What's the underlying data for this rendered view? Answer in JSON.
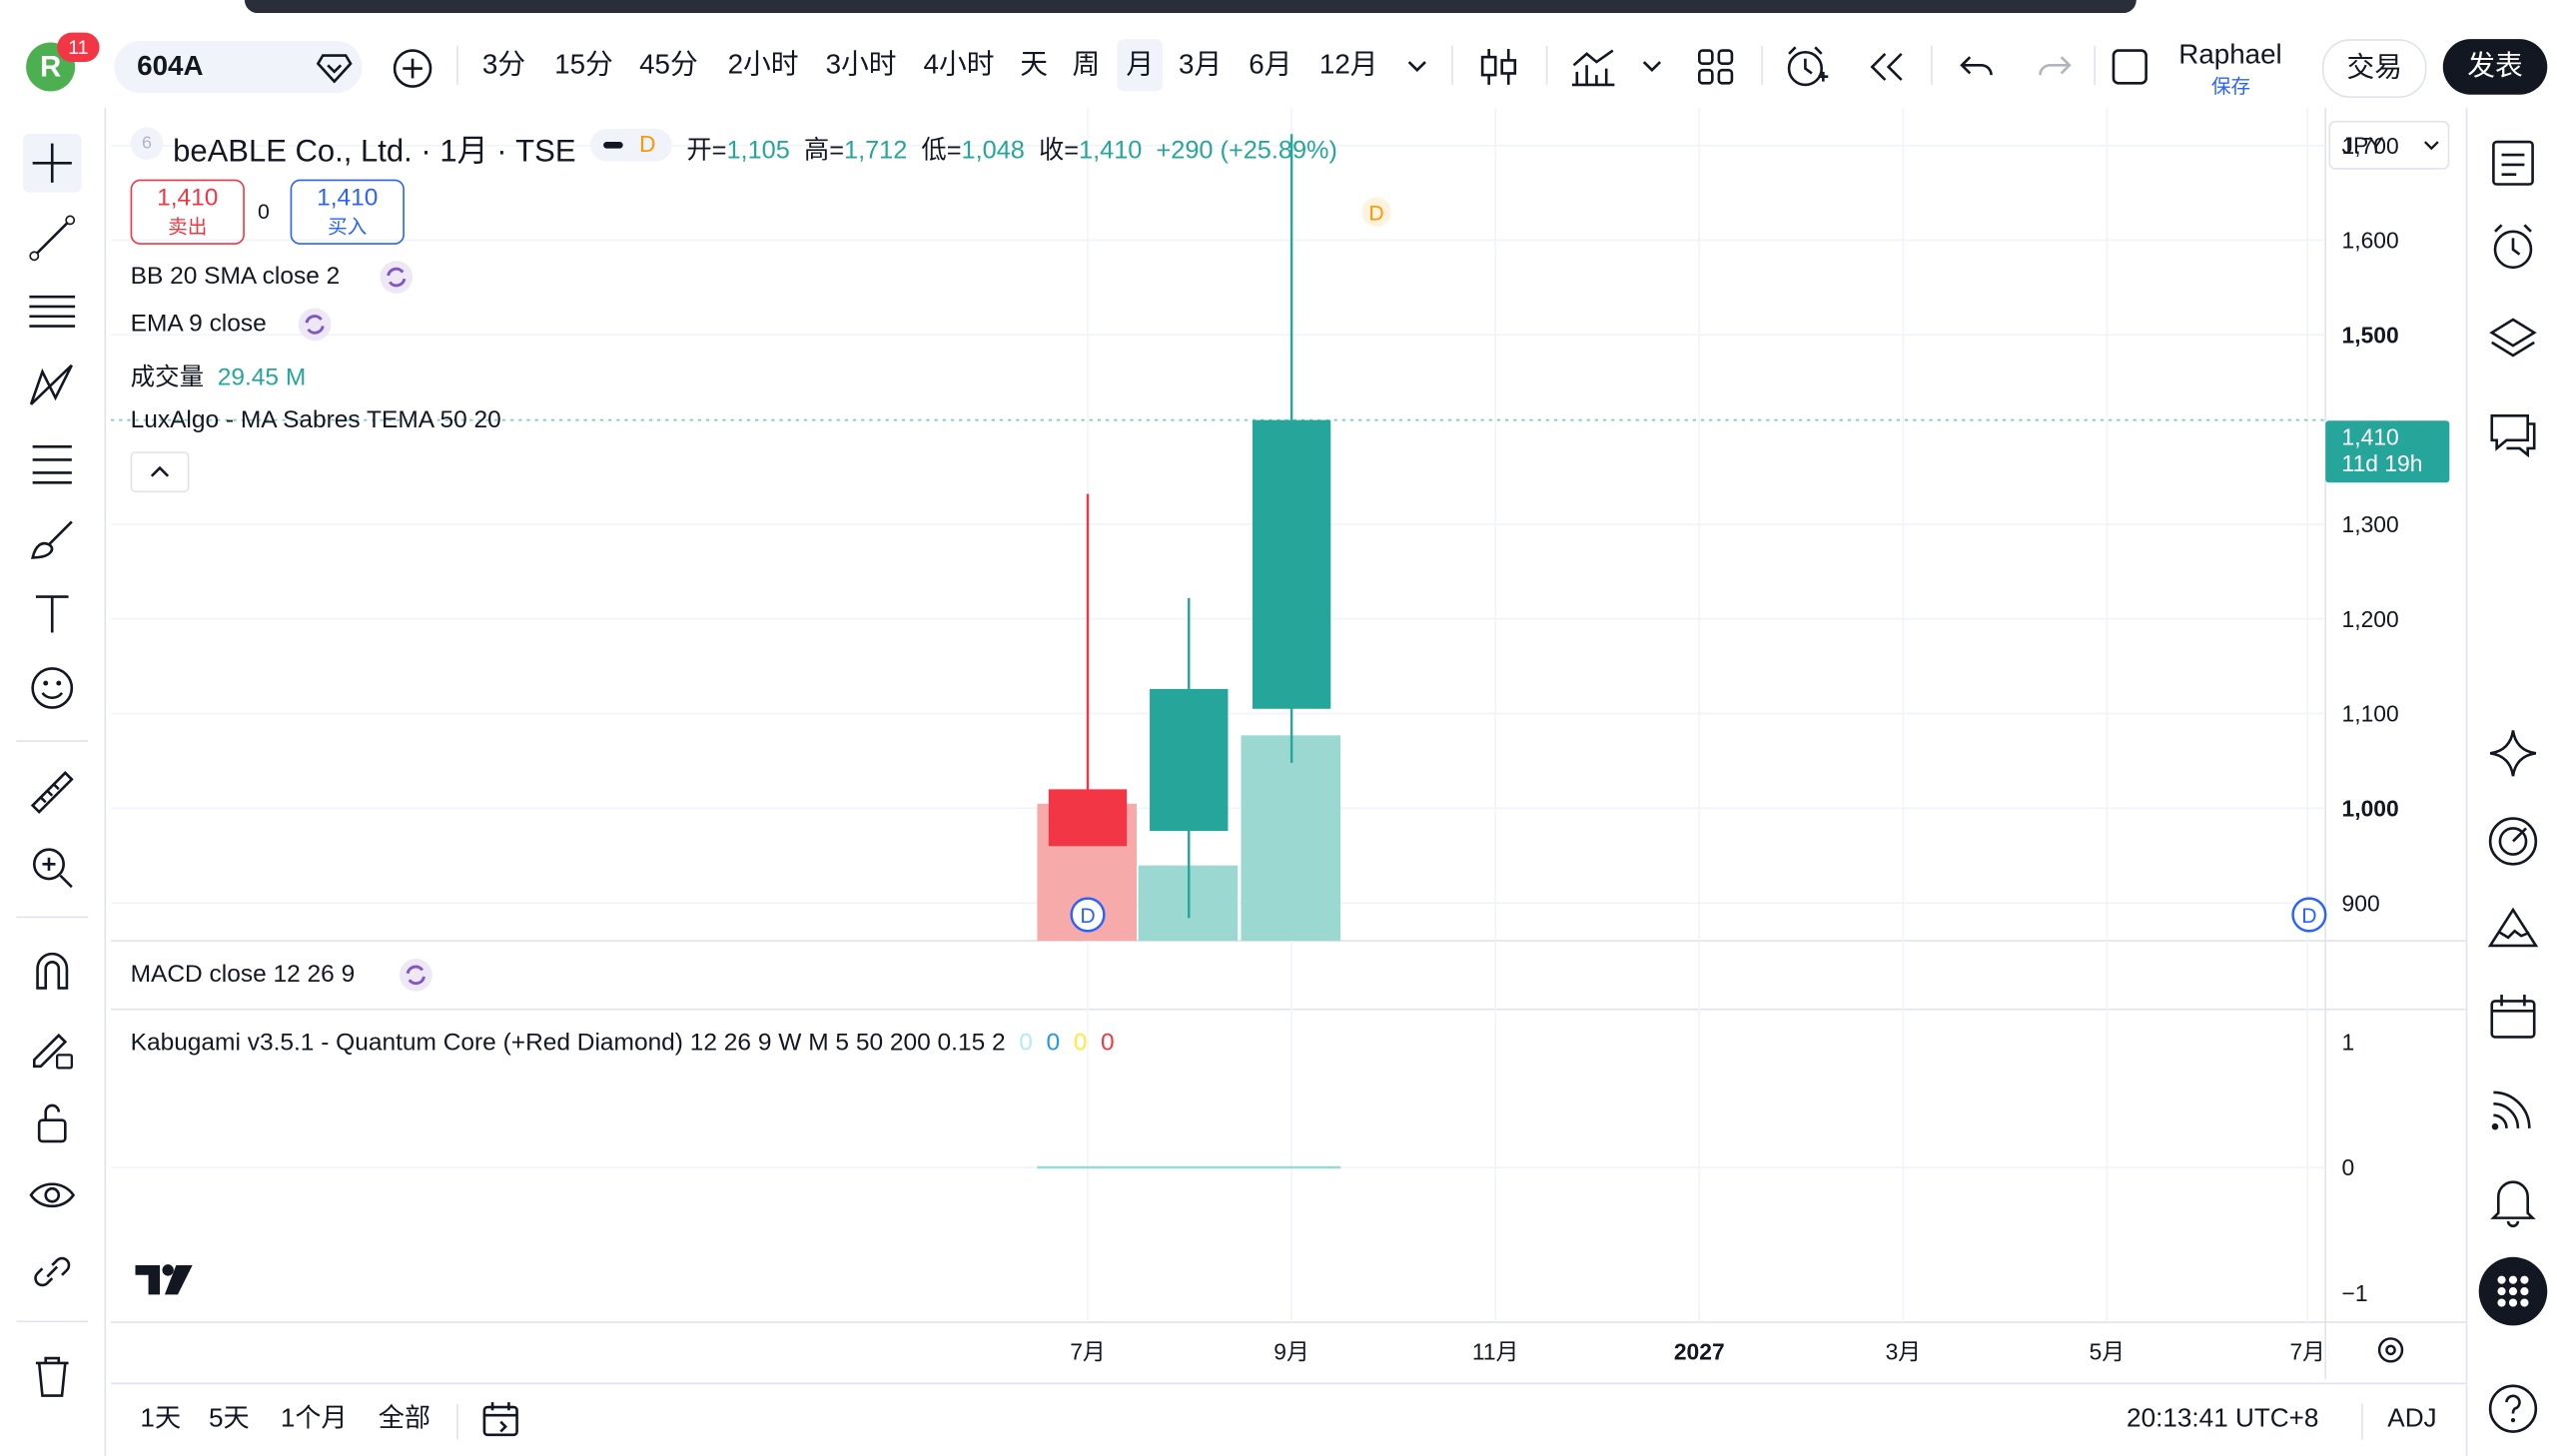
{
  "topbar": {
    "notification_count": "11",
    "avatar_letter": "R",
    "symbol": "604A",
    "intervals": [
      "3分",
      "15分",
      "45分",
      "2小时",
      "3小时",
      "4小时",
      "天",
      "周",
      "月",
      "3月",
      "6月",
      "12月"
    ],
    "active_interval": "月",
    "user_name": "Raphael",
    "save_label": "保存",
    "trade_label": "交易",
    "publish_label": "发表"
  },
  "legend": {
    "badge": "6",
    "title": "beABLE Co., Ltd. · 1月 · TSE",
    "d_badge": "D",
    "open_label": "开=",
    "open": "1,105",
    "high_label": "高=",
    "high": "1,712",
    "low_label": "低=",
    "low": "1,048",
    "close_label": "收=",
    "close": "1,410",
    "change": "+290 (+25.89%)",
    "sell_price": "1,410",
    "sell_label": "卖出",
    "spread": "0",
    "buy_price": "1,410",
    "buy_label": "买入",
    "indicator_bb": "BB 20 SMA close 2",
    "indicator_ema": "EMA 9 close",
    "volume_label": "成交量",
    "volume_value": "29.45 M",
    "indicator_luxalgo": "LuxAlgo - MA Sabres TEMA 50 20",
    "macd_label": "MACD close 12 26 9",
    "kabugami_label": "Kabugami v3.5.1 - Quantum Core (+Red Diamond) 12 26 9 W M 5 50 200 0.15 2",
    "kabugami_values": [
      "0",
      "0",
      "0",
      "0"
    ],
    "kabugami_value_colors": [
      "#b2ebf2",
      "#2196f3",
      "#ffeb3b",
      "#f23645"
    ]
  },
  "price_axis": {
    "currency": "JPY",
    "ticks": [
      "1,700",
      "1,600",
      "1,500",
      "1,300",
      "1,200",
      "1,100",
      "1,000",
      "900"
    ],
    "last_price": "1,410",
    "countdown": "11d 19h"
  },
  "time_axis": {
    "labels": [
      "7月",
      "9月",
      "11月",
      "2027",
      "3月",
      "5月",
      "7月"
    ]
  },
  "osc_axis": {
    "ticks": [
      "1",
      "0",
      "−1"
    ]
  },
  "bottombar": {
    "ranges": [
      "1天",
      "5天",
      "1个月",
      "全部"
    ],
    "clock": "20:13:41 UTC+8",
    "adj": "ADJ"
  },
  "colors": {
    "up": "#26a69a",
    "down": "#f23645",
    "up_vol": "#26a69a80",
    "down_vol": "#f2364580"
  },
  "chart_data": {
    "type": "candlestick",
    "title": "beABLE Co., Ltd. · 1月 · TSE",
    "candles": [
      {
        "x": "2026-06",
        "open": 1020,
        "high": 1332,
        "low": 968,
        "close": 960
      },
      {
        "x": "2026-07",
        "open": 976,
        "high": 1222,
        "low": 884,
        "close": 1126
      },
      {
        "x": "2026-08",
        "open": 1105,
        "high": 1712,
        "low": 1048,
        "close": 1410
      }
    ],
    "volume_colors": [
      "down",
      "up",
      "up"
    ],
    "volume_relative": [
      0.6,
      0.33,
      0.9
    ],
    "ylim": [
      860,
      1740
    ],
    "last_price": 1410,
    "grid": true
  }
}
